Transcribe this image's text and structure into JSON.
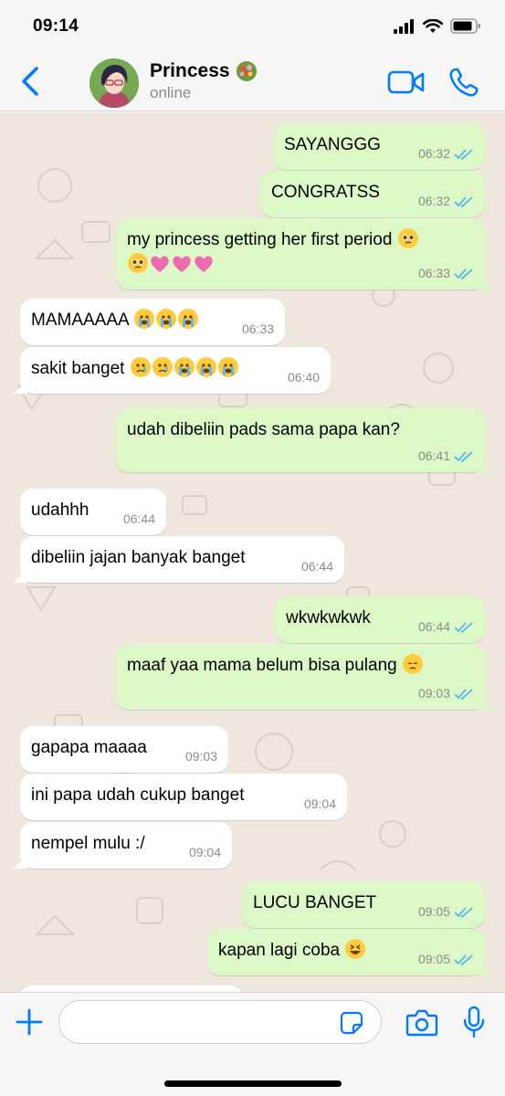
{
  "status_bar": {
    "time": "09:14"
  },
  "header": {
    "contact_name": "Princess",
    "contact_status": "online"
  },
  "messages": [
    {
      "text": "SAYANGGG",
      "time": "06:32",
      "direction": "out"
    },
    {
      "text": "CONGRATSS",
      "time": "06:32",
      "direction": "out"
    },
    {
      "text": "my princess getting her first period",
      "time": "06:33",
      "direction": "out",
      "emojis": [
        "pleading-face-emoji",
        "pleading-face-emoji",
        "pink-heart-emoji",
        "pink-heart-emoji",
        "pink-heart-emoji"
      ]
    },
    {
      "text": "MAMAAAAA",
      "time": "06:33",
      "direction": "in",
      "emojis": [
        "loudly-crying-face-emoji",
        "loudly-crying-face-emoji",
        "loudly-crying-face-emoji"
      ]
    },
    {
      "text": "sakit banget",
      "time": "06:40",
      "direction": "in",
      "emojis": [
        "crying-face-emoji",
        "crying-face-emoji",
        "loudly-crying-face-emoji",
        "loudly-crying-face-emoji",
        "loudly-crying-face-emoji"
      ]
    },
    {
      "text": "udah dibeliin pads sama papa kan?",
      "time": "06:41",
      "direction": "out"
    },
    {
      "text": "udahhh",
      "time": "06:44",
      "direction": "in"
    },
    {
      "text": "dibeliin jajan banyak banget",
      "time": "06:44",
      "direction": "in"
    },
    {
      "text": "wkwkwkwk",
      "time": "06:44",
      "direction": "out"
    },
    {
      "text": "maaf yaa mama belum bisa pulang",
      "time": "09:03",
      "direction": "out",
      "emojis": [
        "pensive-face-emoji"
      ]
    },
    {
      "text": "gapapa maaaa",
      "time": "09:03",
      "direction": "in"
    },
    {
      "text": "ini papa udah cukup banget",
      "time": "09:04",
      "direction": "in"
    },
    {
      "text": "nempel mulu :/",
      "time": "09:04",
      "direction": "in"
    },
    {
      "text": "LUCU BANGET",
      "time": "09:05",
      "direction": "out"
    },
    {
      "text": "kapan lagi coba",
      "time": "09:05",
      "direction": "out",
      "emojis": [
        "grinning-squinting-face-emoji"
      ]
    }
  ],
  "input": {
    "placeholder": "",
    "value": ""
  },
  "colors": {
    "accent": "#007aff",
    "outgoing_bubble": "#dcf8c6",
    "incoming_bubble": "#ffffff",
    "chat_background": "#efe7de",
    "read_ticks": "#4fb4f0",
    "pink_heart": "#f06ab0"
  }
}
